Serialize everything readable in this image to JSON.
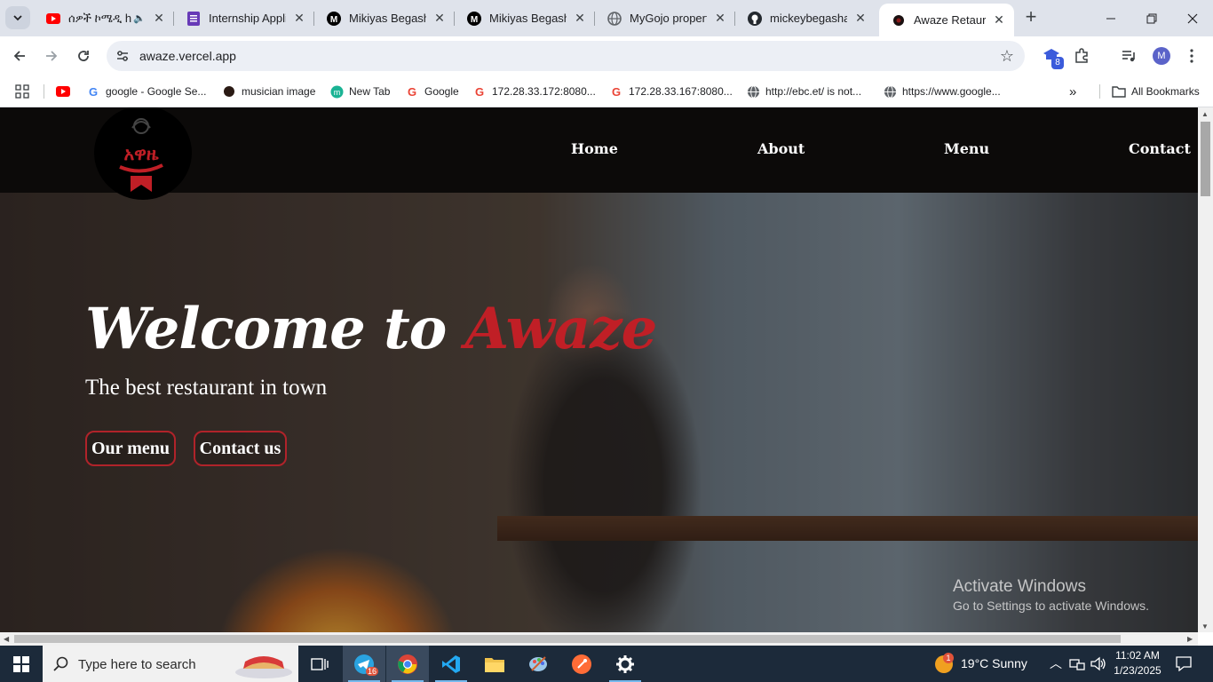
{
  "browser": {
    "tabs": [
      {
        "title": "ሰዎች ኮሜዲ h",
        "favicon": "youtube-icon"
      },
      {
        "title": "Internship Appli",
        "favicon": "forms-icon"
      },
      {
        "title": "Mikiyas Begasha",
        "favicon": "medium-icon"
      },
      {
        "title": "Mikiyas Begasha",
        "favicon": "medium-icon"
      },
      {
        "title": "MyGojo propert",
        "favicon": "globe-icon"
      },
      {
        "title": "mickeybegashaw",
        "favicon": "github-icon"
      },
      {
        "title": "Awaze Retaurant",
        "favicon": "awaze-icon",
        "active": true
      }
    ],
    "url": "awaze.vercel.app",
    "extension_badge": "8",
    "profile_initial": "M",
    "bookmarks": [
      {
        "label": "",
        "favicon": "youtube-icon"
      },
      {
        "label": "google - Google Se...",
        "favicon": "google-icon"
      },
      {
        "label": "musician image",
        "favicon": "musician-icon"
      },
      {
        "label": "New Tab",
        "favicon": "newtab-icon"
      },
      {
        "label": "Google",
        "favicon": "google-icon"
      },
      {
        "label": "172.28.33.172:8080...",
        "favicon": "google-icon"
      },
      {
        "label": "172.28.33.167:8080...",
        "favicon": "google-icon"
      },
      {
        "label": "http://ebc.et/ is not...",
        "favicon": "globe-icon"
      },
      {
        "label": "https://www.google...",
        "favicon": "globe-icon"
      }
    ],
    "all_bookmarks": "All Bookmarks"
  },
  "site": {
    "logo_text": "አዋዜ",
    "nav": [
      "Home",
      "About",
      "Menu",
      "Contact"
    ],
    "welcome": "Welcome to",
    "brand": "Awaze",
    "tagline": "The best restaurant in town",
    "buttons": [
      "Our menu",
      "Contact us"
    ],
    "colors": {
      "accent": "#c01f26",
      "nav_bg": "#0c0a09"
    }
  },
  "watermark": {
    "title": "Activate Windows",
    "subtitle": "Go to Settings to activate Windows."
  },
  "taskbar": {
    "search_placeholder": "Type here to search",
    "telegram_badge": "16",
    "weather": "19°C  Sunny",
    "weather_badge": "1",
    "time": "11:02 AM",
    "date": "1/23/2025"
  }
}
